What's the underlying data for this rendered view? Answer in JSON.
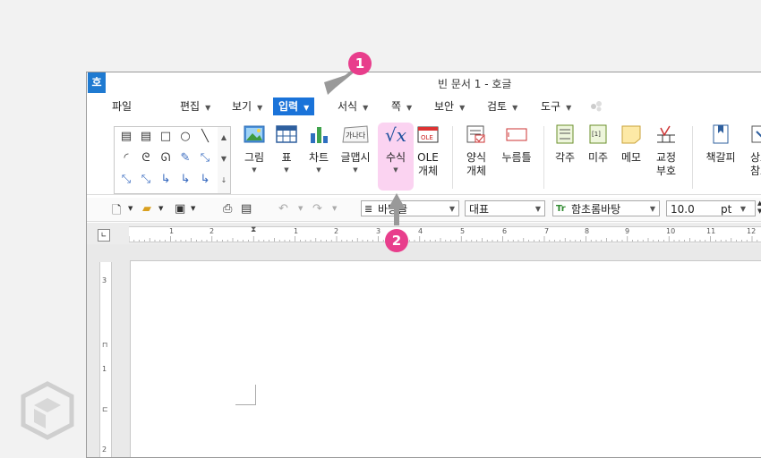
{
  "window": {
    "title": "빈 문서 1 - 호글",
    "app_icon": "호"
  },
  "menu": {
    "items": [
      {
        "label": "파일"
      },
      {
        "label": "편집"
      },
      {
        "label": "보기"
      },
      {
        "label": "입력"
      },
      {
        "label": "서식"
      },
      {
        "label": "쪽"
      },
      {
        "label": "보안"
      },
      {
        "label": "검토"
      },
      {
        "label": "도구"
      }
    ]
  },
  "ribbon": {
    "picture": "그림",
    "table": "표",
    "chart": "차트",
    "glyph": "글맵시",
    "glyph_icon": "가나다",
    "equation": "수식",
    "equation_icon": "√x",
    "ole_line1": "OLE",
    "ole_line2": "개체",
    "ole_icon": "OLE",
    "form_line1": "양식",
    "form_line2": "개체",
    "pushbutton": "누름틀",
    "footnote": "각주",
    "endnote": "미주",
    "endnote_icon": "[1]",
    "memo": "메모",
    "proof_line1": "교정",
    "proof_line2": "부호",
    "bookmark": "책갈피",
    "crossref_line1": "상호",
    "crossref_line2": "참조"
  },
  "toolbar": {
    "style_value": "바탕글",
    "lang_value": "대표",
    "font_value": "함초롬바탕",
    "font_icon": "Tr",
    "size_value": "10.0",
    "size_unit": "pt"
  },
  "ruler": {
    "h_ticks": [
      "1",
      "2",
      "1",
      "2",
      "3",
      "4",
      "5",
      "6",
      "7",
      "8",
      "9",
      "10",
      "11",
      "12"
    ],
    "v_ticks": [
      "1",
      "2",
      "3"
    ]
  },
  "annotations": {
    "step1": "1",
    "step2": "2"
  },
  "colors": {
    "accent": "#1a73d9",
    "highlight": "#fbd3f1",
    "badge": "#e83e8c"
  }
}
